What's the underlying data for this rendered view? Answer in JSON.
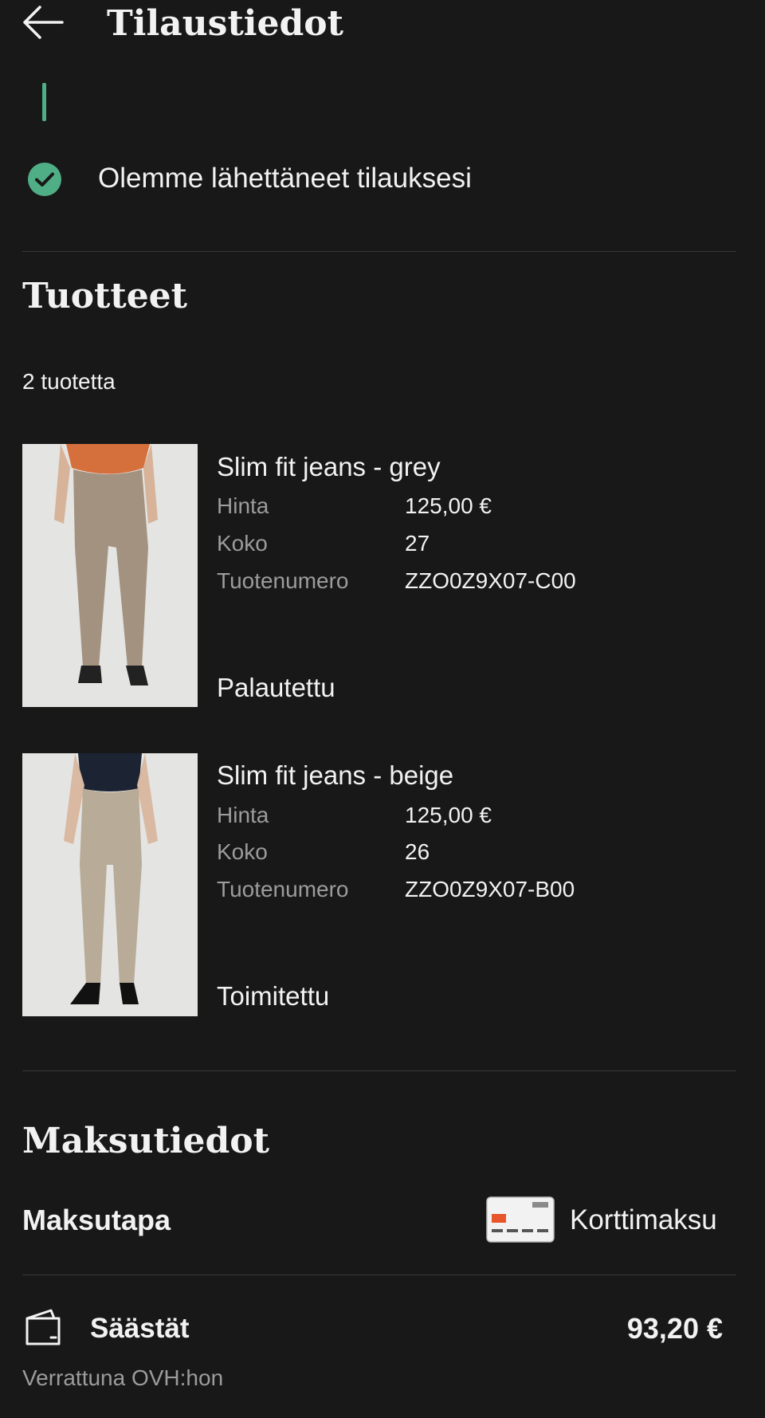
{
  "header": {
    "title": "Tilaustiedot",
    "back_icon": "arrow-left-icon"
  },
  "status": {
    "text": "Olemme lähettäneet tilauksesi",
    "icon": "check-circle-icon",
    "color": "#4fae86"
  },
  "products": {
    "title": "Tuotteet",
    "count": "2 tuotetta",
    "items": [
      {
        "name": "Slim fit jeans - grey",
        "price_label": "Hinta",
        "price": "125,00 €",
        "size_label": "Koko",
        "size": "27",
        "sku_label": "Tuotenumero",
        "sku": "ZZO0Z9X07-C00",
        "status": "Palautettu"
      },
      {
        "name": "Slim fit jeans - beige",
        "price_label": "Hinta",
        "price": "125,00 €",
        "size_label": "Koko",
        "size": "26",
        "sku_label": "Tuotenumero",
        "sku": "ZZO0Z9X07-B00",
        "status": "Toimitettu"
      }
    ]
  },
  "payment": {
    "title": "Maksutiedot",
    "method_label": "Maksutapa",
    "method_value": "Korttimaksu",
    "method_icon": "card-icon",
    "savings_label": "Säästät",
    "savings_amount": "93,20 €",
    "savings_sub": "Verrattuna OVH:hon",
    "savings_icon": "wallet-icon"
  }
}
